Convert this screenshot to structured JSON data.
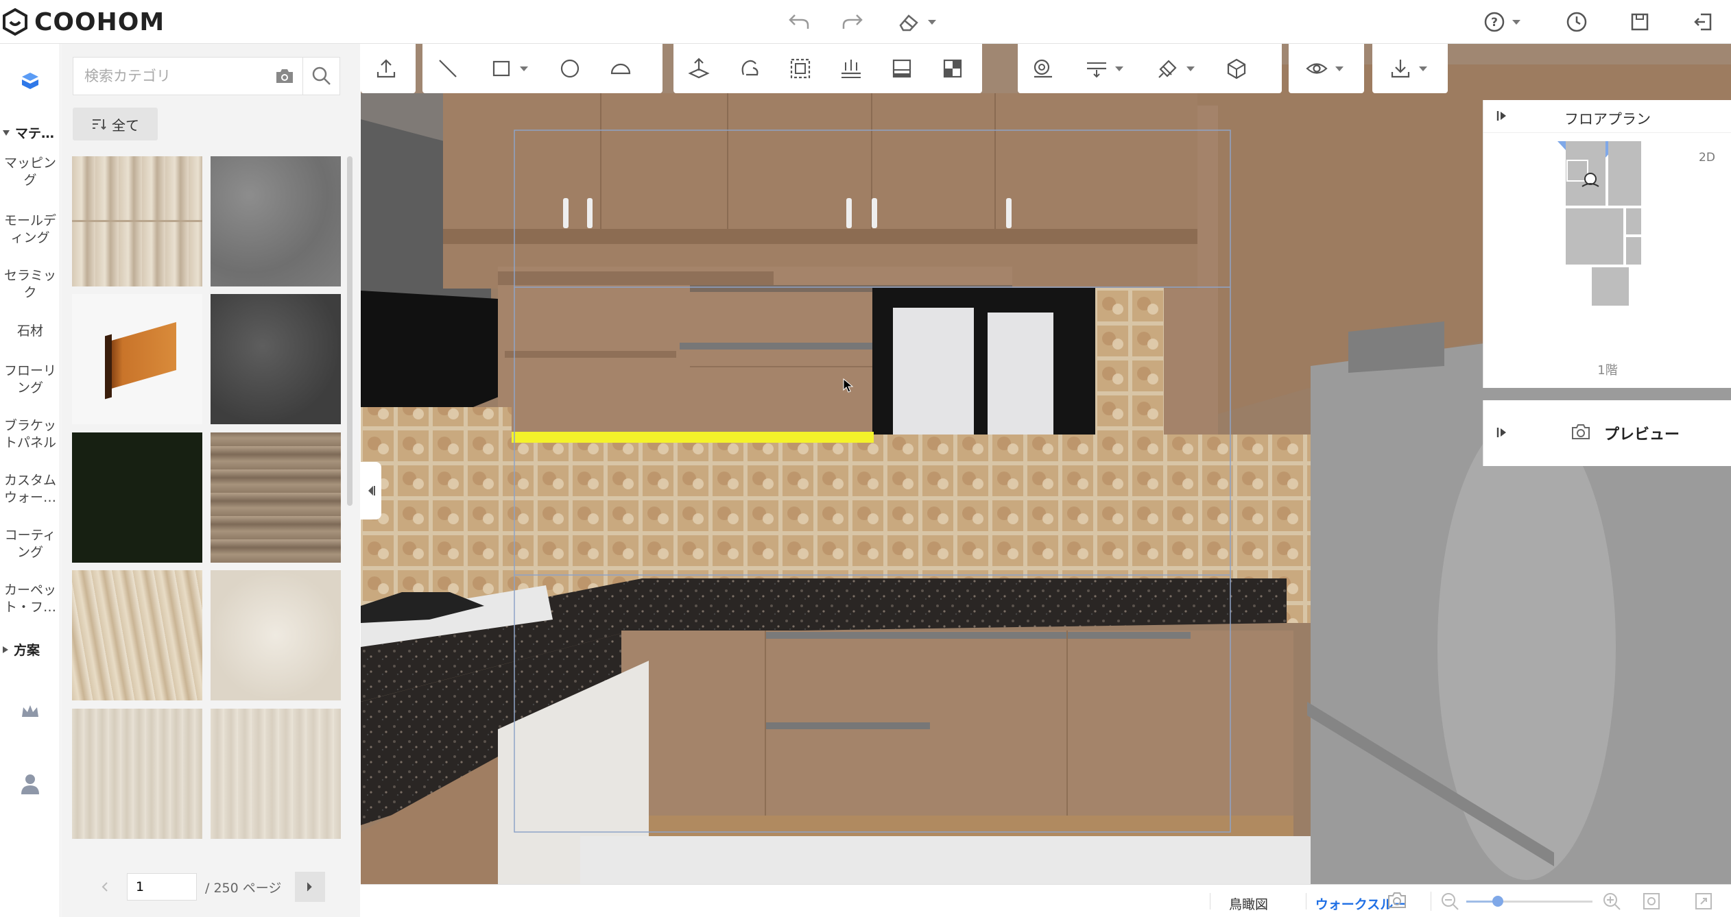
{
  "app": {
    "logo_text": "COOHOM"
  },
  "topbar": {
    "icons": [
      "undo-icon",
      "redo-icon",
      "eraser-icon",
      "help-icon",
      "history-icon",
      "save-icon",
      "exit-icon"
    ]
  },
  "rail": {
    "materials_head": "マテ…",
    "items": [
      "マッピング",
      "モールディング",
      "セラミック",
      "石材",
      "フローリング",
      "ブラケットパネル",
      "カスタムウォー…",
      "コーティング",
      "カーペット・フ…"
    ],
    "plans_head": "方案"
  },
  "panel": {
    "search_placeholder": "検索カテゴリ",
    "filter_label": "全て",
    "pager": {
      "current": "1",
      "total_label": "/ 250 ページ"
    }
  },
  "toolbar": {
    "groups": [
      [
        "upload-icon"
      ],
      [
        "line-icon",
        "rectangle-icon",
        "circle-icon",
        "arc-icon"
      ],
      [
        "lift-icon",
        "hand-icon",
        "select-area-icon",
        "align-icon",
        "layout-icon",
        "panel-icon"
      ],
      [
        "measure-icon",
        "level-icon",
        "paint-icon",
        "cube-icon"
      ],
      [
        "eye-icon"
      ],
      [
        "download-icon"
      ]
    ]
  },
  "floorplan": {
    "title": "フロアプラン",
    "mode": "2D",
    "floor_label": "1階"
  },
  "preview": {
    "title": "プレビュー"
  },
  "bottombar": {
    "view_birdseye": "鳥瞰図",
    "view_walkthrough": "ウォークスルー"
  },
  "colors": {
    "accent": "#1f6fe5",
    "highlight": "#f4f22a"
  }
}
